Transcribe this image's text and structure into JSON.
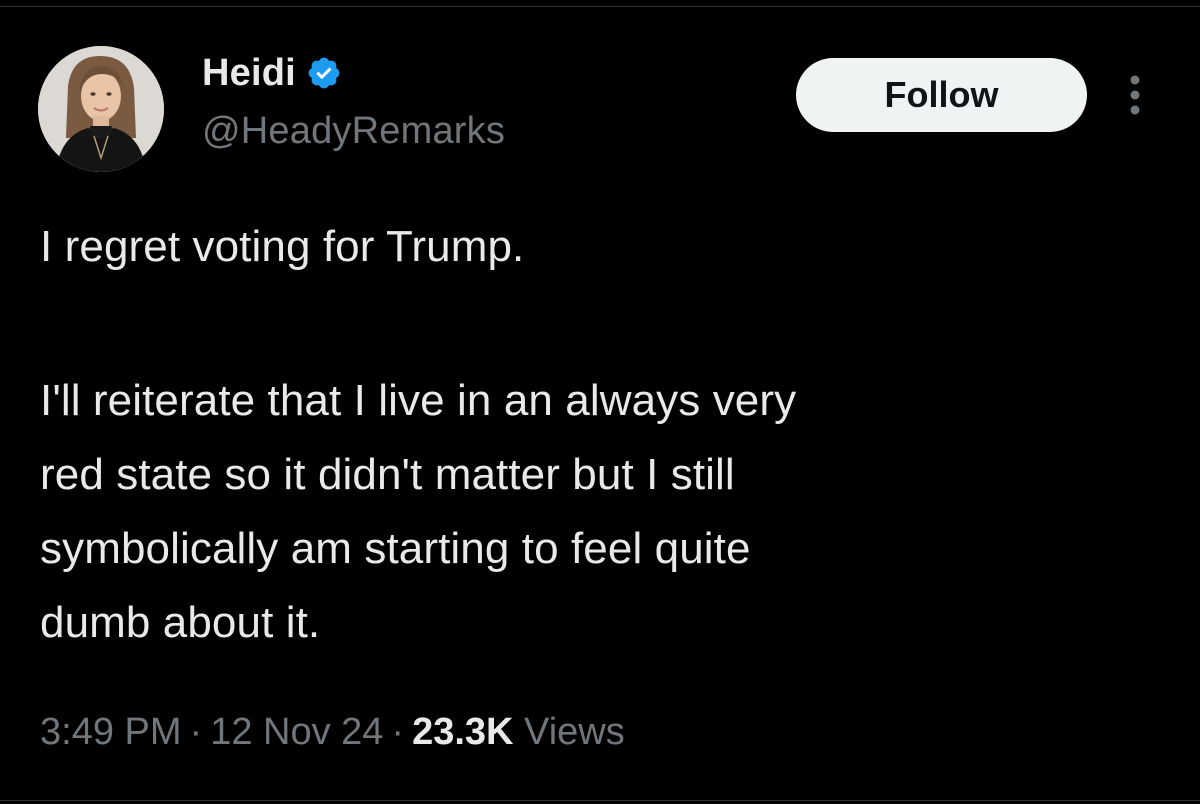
{
  "author": {
    "display_name": "Heidi",
    "handle": "@HeadyRemarks",
    "verified": true
  },
  "actions": {
    "follow_label": "Follow",
    "more_icon": "more-vertical-icon"
  },
  "tweet": {
    "line_1": "I regret voting for Trump.",
    "line_2": "I'll reiterate that I live in an always very",
    "line_3": "red state so it didn't matter but I still",
    "line_4": "symbolically am starting to feel quite",
    "line_5": "dumb about it."
  },
  "meta": {
    "time": "3:49 PM",
    "separator": "·",
    "date": "12 Nov 24",
    "views_count": "23.3K",
    "views_label": "Views"
  },
  "colors": {
    "background": "#000000",
    "text_primary": "#e7e9ea",
    "text_secondary": "#71767b",
    "verified_badge": "#1d9bf0",
    "follow_button_bg": "#eff3f4"
  }
}
